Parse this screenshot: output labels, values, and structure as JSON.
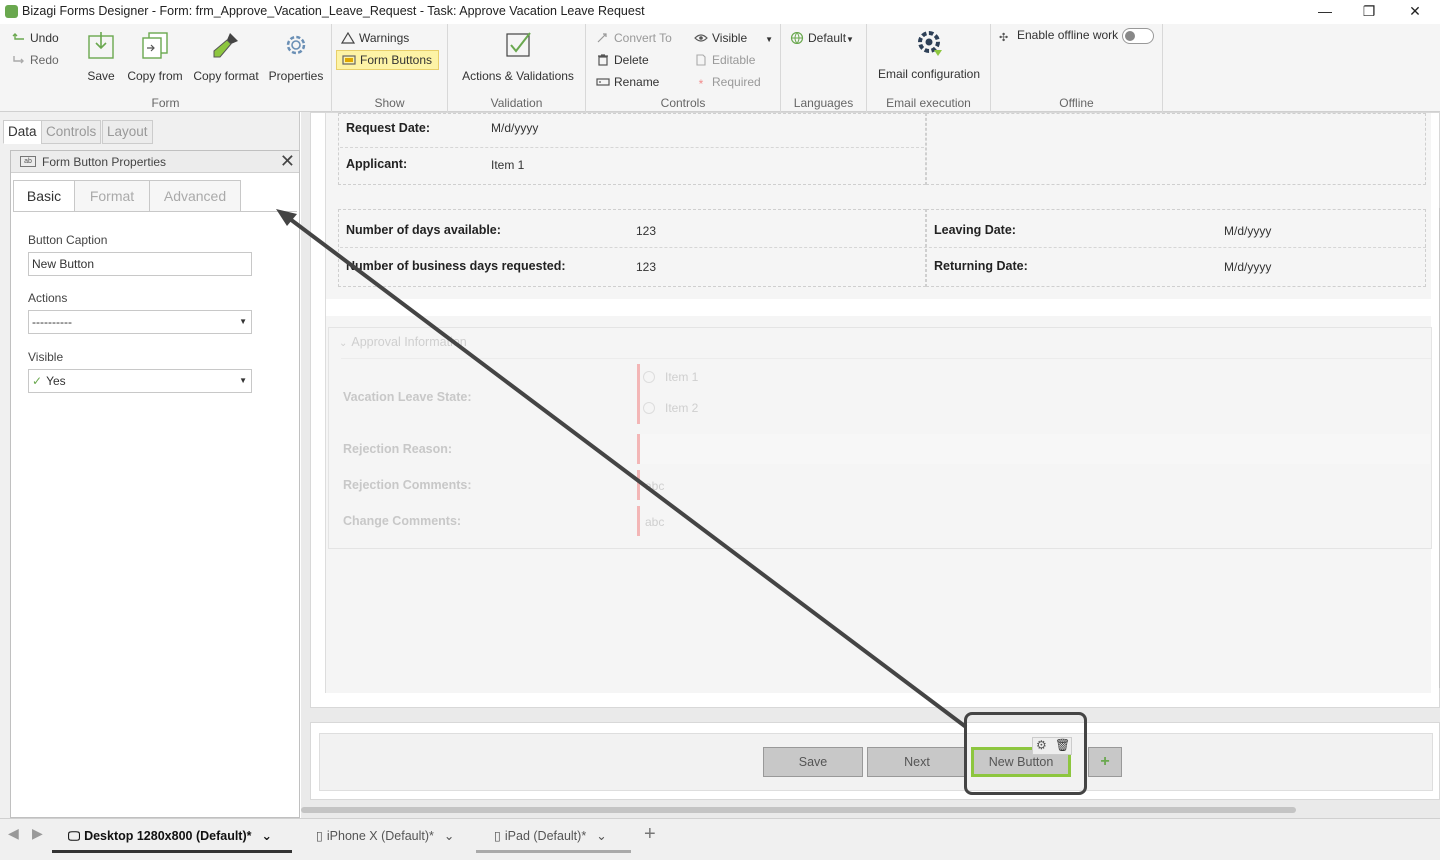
{
  "window": {
    "title": "Bizagi Forms Designer  -  Form: frm_Approve_Vacation_Leave_Request - Task:  Approve Vacation Leave Request",
    "minimize": "—",
    "maximize": "❐",
    "close": "✕"
  },
  "ribbon": {
    "form": {
      "undo": "Undo",
      "redo": "Redo",
      "save": "Save",
      "copy_from": "Copy from",
      "copy_format": "Copy format",
      "properties": "Properties",
      "label": "Form"
    },
    "show": {
      "warnings": "Warnings",
      "form_buttons": "Form Buttons",
      "label": "Show"
    },
    "validation": {
      "actions": "Actions & Validations",
      "label": "Validation"
    },
    "controls": {
      "convert_to": "Convert To",
      "delete": "Delete",
      "rename": "Rename",
      "visible": "Visible",
      "editable": "Editable",
      "required": "Required",
      "label": "Controls"
    },
    "languages": {
      "default": "Default",
      "label": "Languages"
    },
    "email": {
      "config": "Email configuration",
      "label": "Email execution"
    },
    "offline": {
      "enable": "Enable offline work",
      "label": "Offline",
      "enabled": false
    }
  },
  "left_panel": {
    "tabs": [
      "Data",
      "Controls",
      "Layout"
    ],
    "active_tab": "Data",
    "properties_window": {
      "title": "Form Button Properties",
      "tabs": [
        "Basic",
        "Format",
        "Advanced"
      ],
      "active_tab": "Basic",
      "caption_label": "Button Caption",
      "caption_value": "New Button",
      "actions_label": "Actions",
      "actions_value": "----------",
      "visible_label": "Visible",
      "visible_value": "Yes"
    }
  },
  "form": {
    "request_date_label": "Request Date:",
    "request_date_value": "M/d/yyyy",
    "applicant_label": "Applicant:",
    "applicant_value": "Item 1",
    "days_available_label": "Number of days available:",
    "days_available_value": "123",
    "business_days_label": "Number of business days requested:",
    "business_days_value": "123",
    "leaving_date_label": "Leaving Date:",
    "leaving_date_value": "M/d/yyyy",
    "returning_date_label": "Returning Date:",
    "returning_date_value": "M/d/yyyy",
    "approval_group": "Approval Information",
    "state_label": "Vacation Leave State:",
    "state_option1": "Item 1",
    "state_option2": "Item 2",
    "rejection_reason_label": "Rejection Reason:",
    "rejection_comments_label": "Rejection Comments:",
    "rejection_comments_placeholder": "abc",
    "change_comments_label": "Change Comments:",
    "change_comments_placeholder": "abc"
  },
  "form_buttons": {
    "save": "Save",
    "next": "Next",
    "new_button": "New Button",
    "add": "+"
  },
  "bottom_tabs": [
    {
      "label": "Desktop 1280x800 (Default)",
      "modified": "*"
    },
    {
      "label": "iPhone X (Default)",
      "modified": "*"
    },
    {
      "label": "iPad (Default)",
      "modified": "*"
    }
  ],
  "colors": {
    "accent_green": "#8dc63f",
    "highlight_yellow": "#fdf3a6",
    "annotation": "#444444"
  }
}
